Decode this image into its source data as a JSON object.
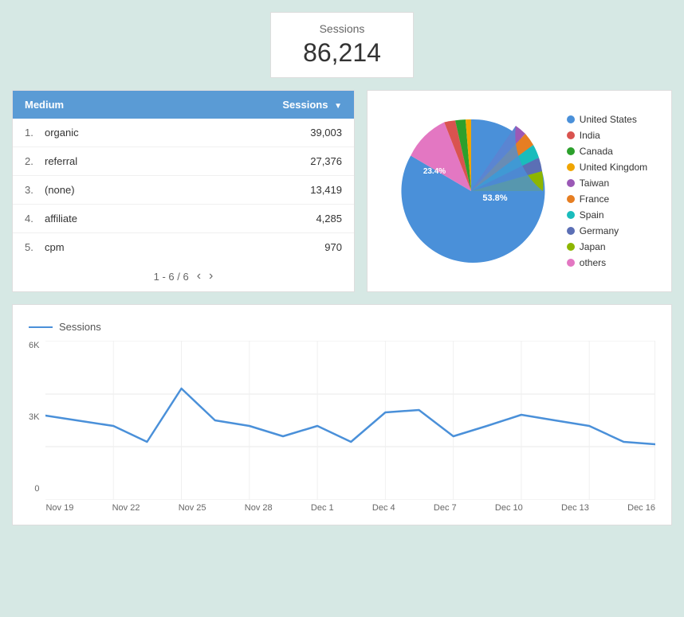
{
  "sessions_card": {
    "label": "Sessions",
    "value": "86,214"
  },
  "table": {
    "col_medium": "Medium",
    "col_sessions": "Sessions",
    "pagination": "1 - 6 / 6",
    "rows": [
      {
        "num": "1.",
        "medium": "organic",
        "sessions": "39,003"
      },
      {
        "num": "2.",
        "medium": "referral",
        "sessions": "27,376"
      },
      {
        "num": "3.",
        "medium": "(none)",
        "sessions": "13,419"
      },
      {
        "num": "4.",
        "medium": "affiliate",
        "sessions": "4,285"
      },
      {
        "num": "5.",
        "medium": "cpm",
        "sessions": "970"
      }
    ]
  },
  "pie": {
    "center_label": "53.8%",
    "pink_label": "23.4%",
    "legend": [
      {
        "label": "United States",
        "color": "#4a90d9"
      },
      {
        "label": "India",
        "color": "#d9534f"
      },
      {
        "label": "Canada",
        "color": "#2ca02c"
      },
      {
        "label": "United Kingdom",
        "color": "#f0a500"
      },
      {
        "label": "Taiwan",
        "color": "#9b59b6"
      },
      {
        "label": "France",
        "color": "#e67e22"
      },
      {
        "label": "Spain",
        "color": "#1abcbc"
      },
      {
        "label": "Germany",
        "color": "#5b6fb5"
      },
      {
        "label": "Japan",
        "color": "#8db600"
      },
      {
        "label": "others",
        "color": "#e377c2"
      }
    ]
  },
  "line_chart": {
    "title": "Sessions",
    "y_labels": [
      "6K",
      "3K",
      "0"
    ],
    "x_labels": [
      "Nov 19",
      "Nov 22",
      "Nov 25",
      "Nov 28",
      "Dec 1",
      "Dec 4",
      "Dec 7",
      "Dec 10",
      "Dec 13",
      "Dec 16"
    ]
  }
}
